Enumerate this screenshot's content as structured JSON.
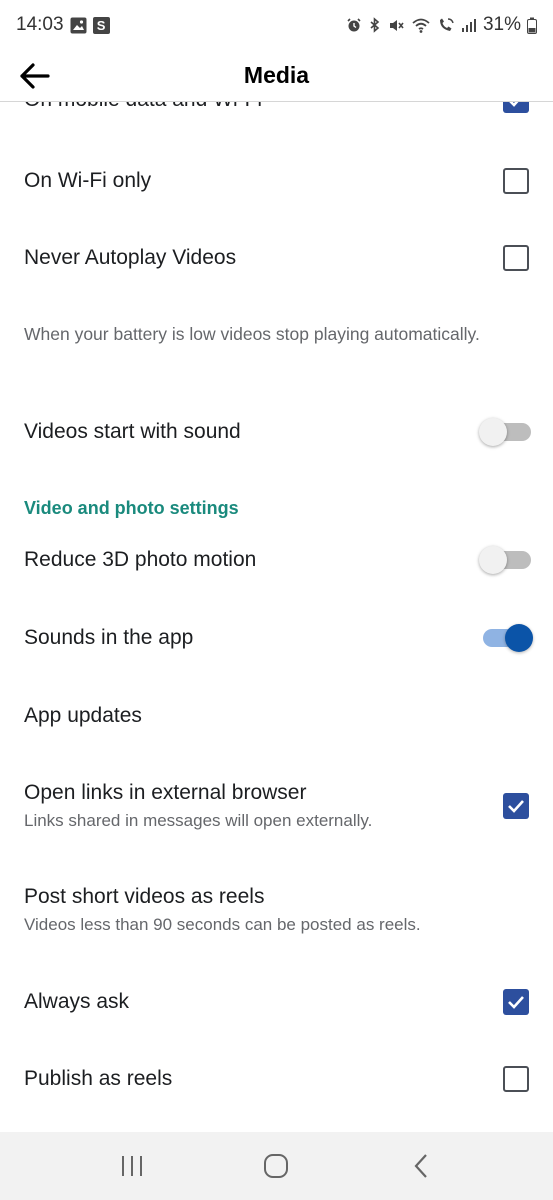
{
  "status_bar": {
    "time": "14:03",
    "left_icons": [
      "image-icon",
      "s-app-icon"
    ],
    "s_app_letter": "S",
    "right_icons": [
      "alarm-icon",
      "bluetooth-icon",
      "mute-icon",
      "wifi-icon",
      "wifi-call-icon",
      "signal-icon"
    ],
    "battery": "31%"
  },
  "header": {
    "title": "Media",
    "back_icon": "arrow-left-icon"
  },
  "rows": {
    "mobile_and_wifi": {
      "label": "On mobile data and Wi-Fi",
      "checked": true
    },
    "wifi_only": {
      "label": "On Wi-Fi only",
      "checked": false
    },
    "never_autoplay": {
      "label": "Never Autoplay Videos",
      "checked": false
    },
    "battery_note": "When your battery is low videos stop playing automatically.",
    "start_with_sound": {
      "label": "Videos start with sound",
      "on": false
    },
    "section_video_photo": "Video and photo settings",
    "reduce_3d": {
      "label": "Reduce 3D photo motion",
      "on": false
    },
    "sounds_in_app": {
      "label": "Sounds in the app",
      "on": true
    },
    "app_updates": {
      "label": "App updates"
    },
    "open_links_external": {
      "label": "Open links in external browser",
      "sub": "Links shared in messages will open externally.",
      "checked": true
    },
    "post_short_videos": {
      "label": "Post short videos as reels",
      "sub": "Videos less than 90 seconds can be posted as reels."
    },
    "always_ask": {
      "label": "Always ask",
      "checked": true
    },
    "publish_as_reels": {
      "label": "Publish as reels",
      "checked": false
    }
  },
  "colors": {
    "accent_blue": "#2d4f9e",
    "toggle_on": "#0b54a8",
    "section_teal": "#1a8a7d"
  },
  "nav_bar": {
    "recents_icon": "recents-icon",
    "home_icon": "home-icon",
    "back_icon": "back-chevron-icon"
  }
}
